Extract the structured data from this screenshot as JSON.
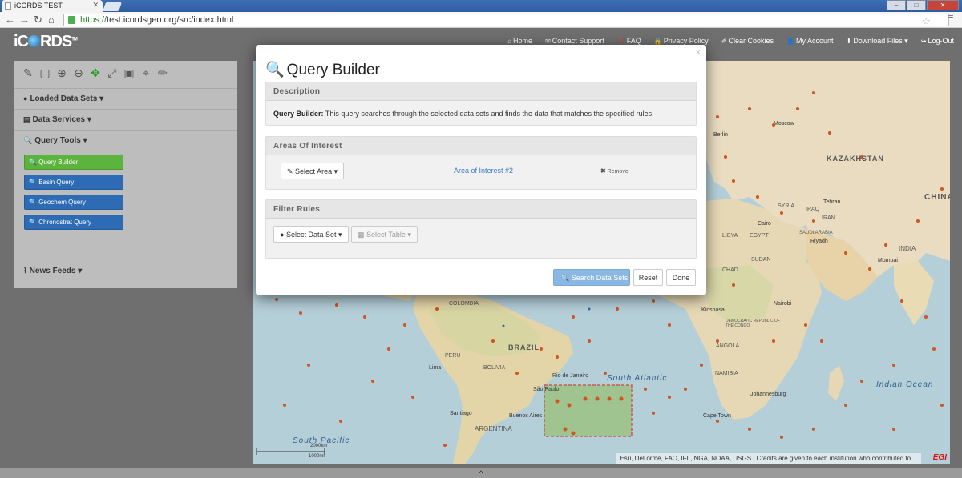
{
  "browser": {
    "tab_title": "iCORDS TEST",
    "url_scheme": "https://",
    "url_rest": "test.icordsgeo.org/src/index.html"
  },
  "app": {
    "logo_text": "iC",
    "logo_rest": "RDS",
    "logo_tm": "TM"
  },
  "topnav": [
    {
      "icon": "home-icon",
      "glyph": "⌂",
      "label": "Home"
    },
    {
      "icon": "envelope-icon",
      "glyph": "✉",
      "label": "Contact Support"
    },
    {
      "icon": "question-icon",
      "glyph": "❓",
      "label": "FAQ"
    },
    {
      "icon": "lock-icon",
      "glyph": "🔒",
      "label": "Privacy Policy"
    },
    {
      "icon": "eraser-icon",
      "glyph": "✐",
      "label": "Clear Cookies"
    },
    {
      "icon": "user-icon",
      "glyph": "👤",
      "label": "My Account"
    },
    {
      "icon": "download-icon",
      "glyph": "⬇",
      "label": "Download Files ▾"
    },
    {
      "icon": "logout-icon",
      "glyph": "↪",
      "label": "Log-Out"
    }
  ],
  "sidebar": {
    "loaded_data_sets": "Loaded Data Sets",
    "data_services": "Data Services",
    "query_tools": "Query Tools",
    "query_buttons": [
      "Query Builder",
      "Basin Query",
      "Geochem Query",
      "Chronostrat Query"
    ],
    "news_feeds": "News Feeds"
  },
  "modal": {
    "title": "Query Builder",
    "description_heading": "Description",
    "description_bold": "Query Builder:",
    "description_text": " This query searches through the selected data sets and finds the data that matches the specified rules.",
    "aoi_heading": "Areas Of Interest",
    "select_area": "Select Area",
    "aoi_name": "Area of Interest #2",
    "remove": "Remove",
    "filter_heading": "Filter Rules",
    "select_data_set": "Select Data Set",
    "select_table": "Select Table",
    "search_button": "Search Data Sets",
    "reset_button": "Reset",
    "done_button": "Done"
  },
  "map": {
    "labels": {
      "kazakhstan": "KAZAKHSTAN",
      "china": "CHINA",
      "libya": "LIBYA",
      "egypt": "EGYPT",
      "sudan": "SUDAN",
      "chad": "CHAD",
      "brazil": "BRAZIL",
      "bolivia": "BOLIVIA",
      "argentina": "ARGENTINA",
      "south_atlantic": "South Atlantic",
      "indian_ocean": "Indian Ocean",
      "south_pacific": "South Pacific",
      "iran": "IRAN",
      "india": "INDIA",
      "syria": "SYRIA",
      "iraq": "IRAQ",
      "saudi": "SAUDI ARABIA",
      "angola": "ANGOLA",
      "namibia": "NAMIBIA",
      "drc": "DEMOCRATIC REPUBLIC OF THE CONGO",
      "peru": "PERU",
      "colombia": "COLOMBIA",
      "rio": "Rio de Janeiro",
      "sao_paulo": "São Paulo",
      "buenos_aires": "Buenos Aires",
      "santiago": "Santiago",
      "cape_town": "Cape Town",
      "johannesburg": "Johannesburg",
      "moscow": "Moscow",
      "berlin": "Berlin",
      "cairo": "Cairo",
      "lima": "Lima",
      "mumbai": "Mumbai",
      "nairobi": "Nairobi",
      "kinshasa": "Kinshasa",
      "riyadh": "Riyadh",
      "tehran": "Tehran"
    },
    "scale_top": "2000km",
    "scale_bottom": "1000mi",
    "attribution": "Esri, DeLorme, FAO, IFL, NGA, NOAA, USGS | Credits are given to each institution who contributed to ...",
    "egi": "EGI"
  },
  "bottom_toggle": "^"
}
